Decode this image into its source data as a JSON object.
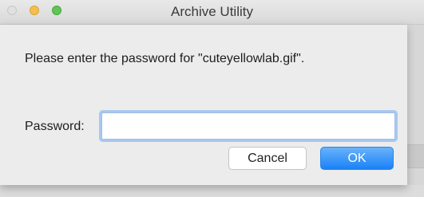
{
  "window": {
    "title": "Archive Utility"
  },
  "titlebar": {
    "buttons": [
      {
        "name": "close",
        "color": "#e1e1e1"
      },
      {
        "name": "minimize",
        "color": "#f5bf4f"
      },
      {
        "name": "zoom",
        "color": "#61c454"
      }
    ]
  },
  "dialog": {
    "message": "Please enter the password for \"cuteyellowlab.gif\".",
    "password_label": "Password:",
    "password_value": "",
    "password_placeholder": "",
    "cancel_label": "Cancel",
    "ok_label": "OK"
  },
  "colors": {
    "accent": "#1a82f6",
    "focus_ring": "#a9c8f0"
  }
}
